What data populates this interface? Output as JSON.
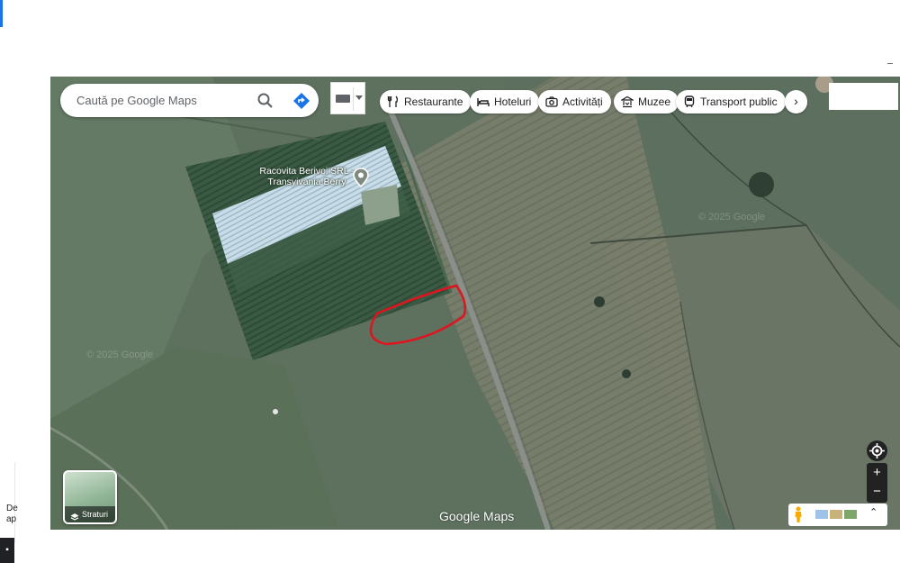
{
  "search": {
    "placeholder": "Caută pe Google Maps"
  },
  "chips": [
    {
      "label": "Restaurante",
      "icon": "fork-knife-icon"
    },
    {
      "label": "Hoteluri",
      "icon": "bed-icon"
    },
    {
      "label": "Activități",
      "icon": "camera-icon"
    },
    {
      "label": "Muzee",
      "icon": "museum-icon"
    },
    {
      "label": "Transport public",
      "icon": "train-icon"
    }
  ],
  "place": {
    "name": "Racovita Berivoi SRL - Transyivania Berry"
  },
  "watermarks": [
    "© 2025 Google",
    "© 2025 Google"
  ],
  "layers": {
    "label": "Straturi"
  },
  "logo": {
    "text": "Google Maps"
  },
  "zoom": {
    "in": "+",
    "out": "−"
  },
  "left_panel": {
    "line1": "De",
    "line2": "ap"
  },
  "colors": {
    "drawn_outline": "#e0141e",
    "road": "#8a8f8a",
    "greenhouse": "#c7dbe6"
  }
}
